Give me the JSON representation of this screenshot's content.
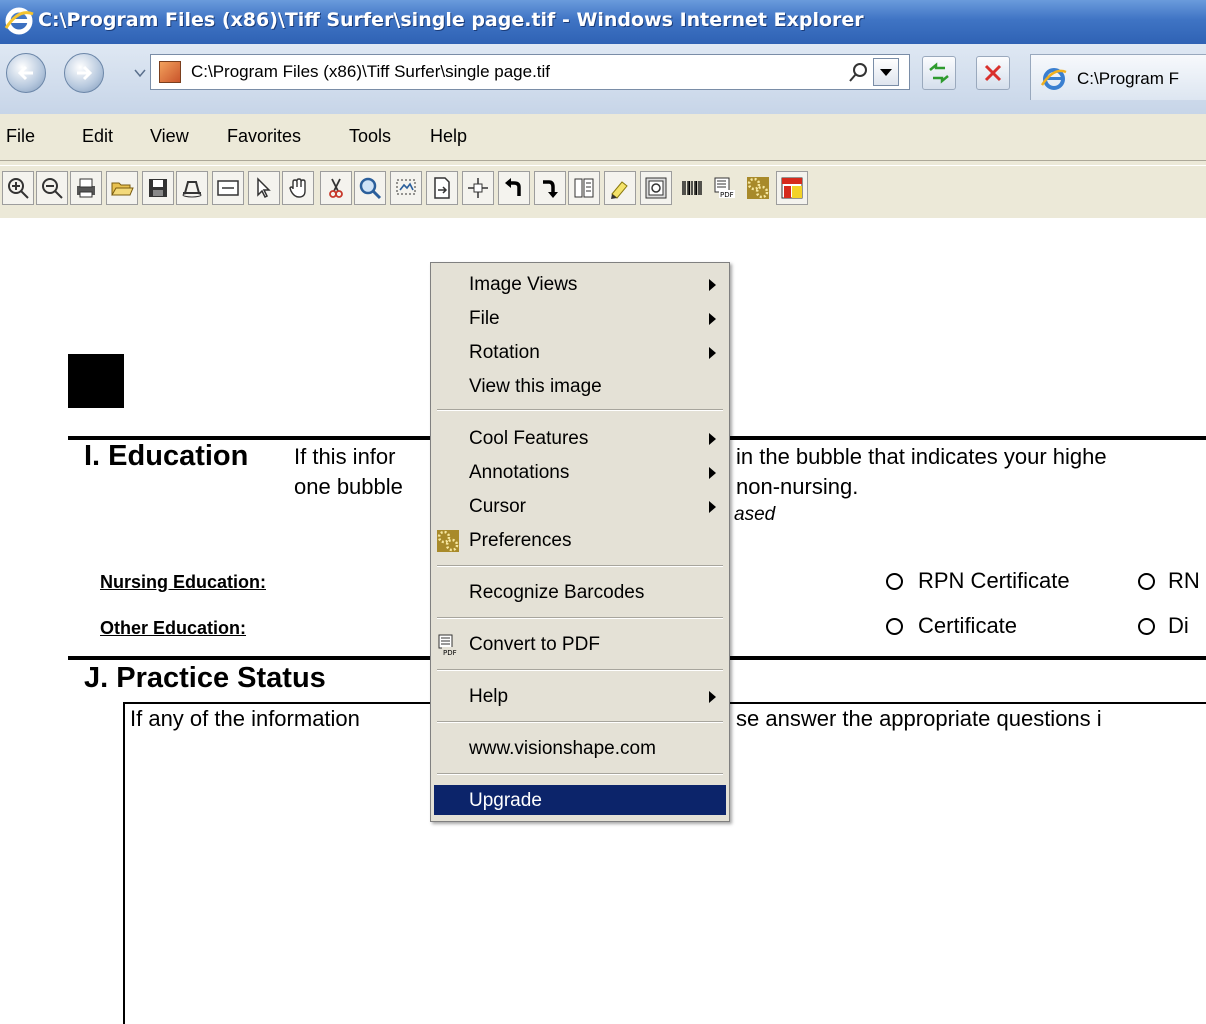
{
  "window": {
    "title": "C:\\Program Files (x86)\\Tiff Surfer\\single page.tif - Windows Internet Explorer"
  },
  "address_bar": {
    "url": "C:\\Program Files (x86)\\Tiff Surfer\\single page.tif"
  },
  "tab": {
    "label": "C:\\Program F"
  },
  "menubar": {
    "items": [
      "File",
      "Edit",
      "View",
      "Favorites",
      "Tools",
      "Help"
    ]
  },
  "toolbar": {
    "icons": [
      "zoom-in-icon",
      "zoom-out-icon",
      "print-icon",
      "open-folder-icon",
      "save-icon",
      "scan-icon",
      "fit-width-icon",
      "pointer-icon",
      "hand-pan-icon",
      "cut-icon",
      "magnify-icon",
      "select-region-icon",
      "fit-page-icon",
      "center-icon",
      "rotate-left-icon",
      "rotate-right-icon",
      "thumbnails-icon",
      "annotate-icon",
      "image-properties-icon",
      "barcode-icon",
      "pdf-icon",
      "preferences-icon",
      "upgrade-icon"
    ]
  },
  "document": {
    "section_i_title": "I. Education",
    "section_i_line1_left": "If this infor",
    "section_i_line1_right": "in the bubble that indicates your highe",
    "section_i_line2_left": "one bubble",
    "section_i_line2_right": "non-nursing.",
    "section_i_line3_right": "ased",
    "nursing_education_label": "Nursing Education:",
    "other_education_label": "Other Education:",
    "rpn_certificate": "RPN Certificate",
    "rn_partial": "RN",
    "certificate": "Certificate",
    "diploma_partial": "Di",
    "section_j_title": "J. Practice Status",
    "section_j_text_left": "If any of the information",
    "section_j_text_right": "se answer the appropriate questions i"
  },
  "context_menu": {
    "items": [
      {
        "label": "Image Views",
        "submenu": true
      },
      {
        "label": "File",
        "submenu": true
      },
      {
        "label": "Rotation",
        "submenu": true
      },
      {
        "label": "View this image",
        "submenu": false
      },
      {
        "label": "Cool Features",
        "submenu": true
      },
      {
        "label": "Annotations",
        "submenu": true
      },
      {
        "label": "Cursor",
        "submenu": true
      },
      {
        "label": "Preferences",
        "submenu": false,
        "icon": "preferences-icon"
      },
      {
        "label": "Recognize Barcodes",
        "submenu": false
      },
      {
        "label": "Convert to PDF",
        "submenu": false,
        "icon": "pdf-icon"
      },
      {
        "label": "Help",
        "submenu": true
      },
      {
        "label": "www.visionshape.com",
        "submenu": false
      },
      {
        "label": "Upgrade",
        "submenu": false,
        "highlighted": true
      }
    ]
  },
  "colors": {
    "title_bar": "#3f74c4",
    "menu_highlight": "#0c246a",
    "menu_background": "#e4e1d6"
  }
}
